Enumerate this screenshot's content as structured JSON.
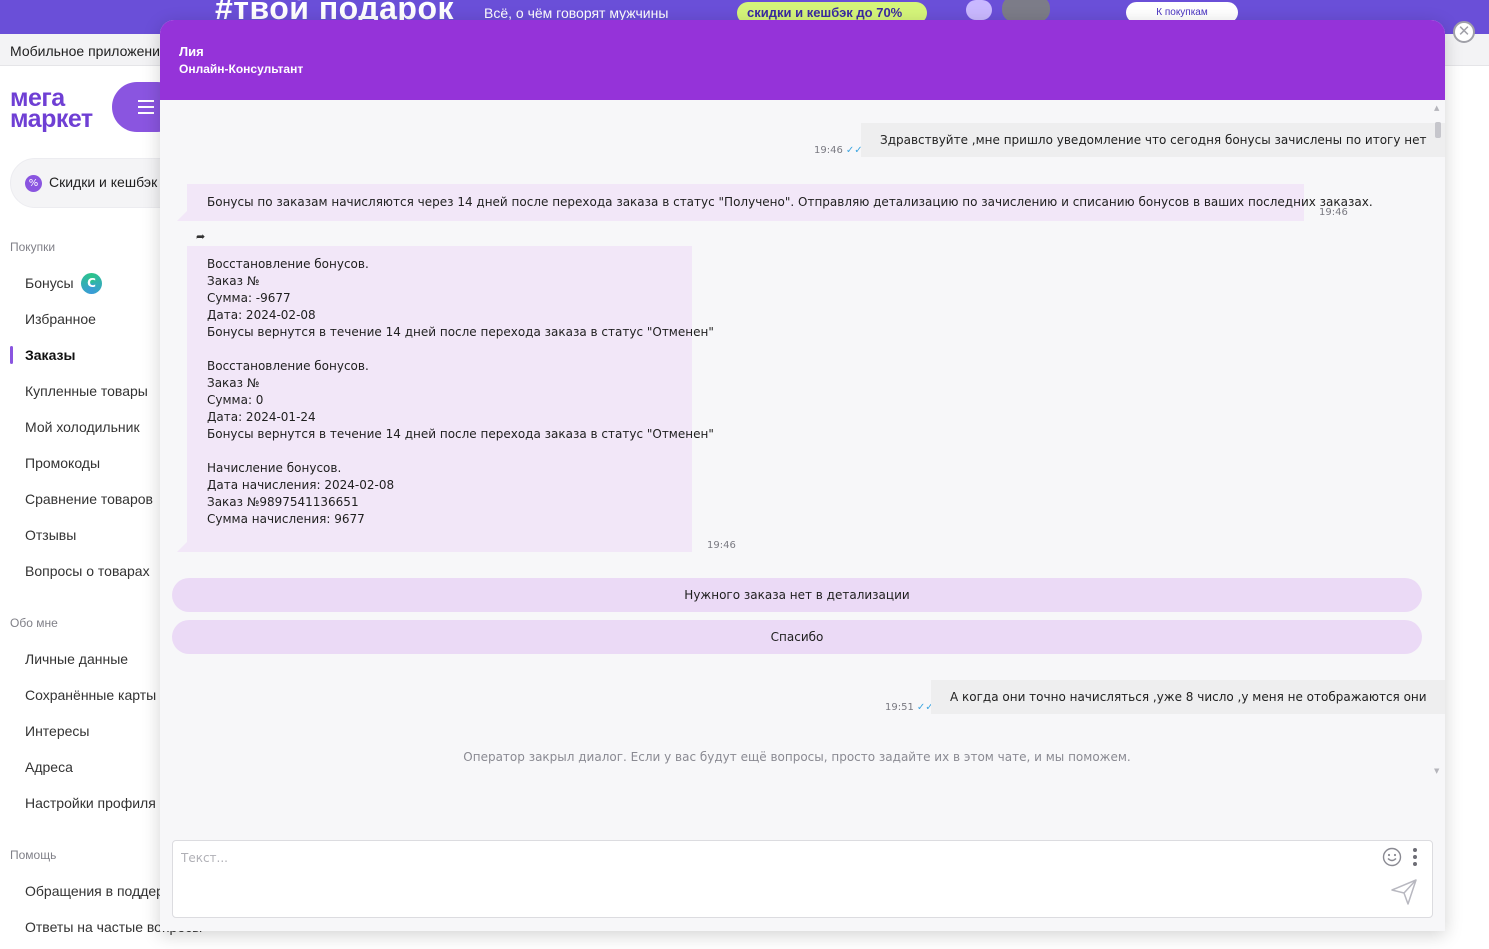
{
  "background": {
    "promo": {
      "hashtag": "#твой подарок",
      "subtitle": "Всё, о чём говорят мужчины",
      "pill": "скидки и кешбэк до 70%",
      "button": "К покупкам"
    },
    "appbar_text": "Мобильное приложение",
    "logo": {
      "line1": "мега",
      "line2": "маркет"
    },
    "search_text": "Скидки и кешбэк",
    "sidebar": {
      "sections": [
        {
          "label": "Покупки",
          "items": [
            "Бонусы",
            "Избранное",
            "Заказы",
            "Купленные товары",
            "Мой холодильник",
            "Промокоды",
            "Сравнение товаров",
            "Отзывы",
            "Вопросы о товарах"
          ]
        },
        {
          "label": "Обо мне",
          "items": [
            "Личные данные",
            "Сохранённые карты",
            "Интересы",
            "Адреса",
            "Настройки профиля"
          ]
        },
        {
          "label": "Помощь",
          "items": [
            "Обращения в поддержку",
            "Ответы на частые вопросы"
          ]
        }
      ],
      "active_item": "Заказы",
      "bonus_badge": "C"
    }
  },
  "chat": {
    "agent_name": "Лия",
    "agent_role": "Онлайн-Консультант",
    "close_glyph": "✕",
    "messages": [
      {
        "direction": "out",
        "text": "Здравствуйте ,мне пришло уведомление что сегодня бонусы зачислены по итогу нет",
        "time": "19:46",
        "read": "✓✓"
      },
      {
        "direction": "in",
        "text": "Бонусы по заказам начисляются через 14 дней после перехода заказа в статус \"Получено\". Отправляю детализацию по зачислению и списанию бонусов в ваших последних заказах.",
        "time": "19:46"
      },
      {
        "direction": "in",
        "forwarded_glyph": "➦",
        "time": "19:46",
        "blocks": [
          [
            "Восстановление бонусов.",
            "Заказ №",
            "Сумма: -9677",
            "Дата: 2024-02-08",
            "Бонусы вернутся в течение 14 дней после перехода заказа в статус \"Отменен\""
          ],
          [
            "Восстановление бонусов.",
            "Заказ №",
            "Сумма: 0",
            "Дата: 2024-01-24",
            "Бонусы вернутся в течение 14 дней после перехода заказа в статус \"Отменен\""
          ],
          [
            "Начисление бонусов.",
            "Дата начисления: 2024-02-08",
            "Заказ №9897541136651",
            "Сумма начисления: 9677"
          ]
        ]
      },
      {
        "direction": "out",
        "text": "А когда они точно начисляться ,уже 8 число ,у меня не отображаются они",
        "time": "19:51",
        "read": "✓✓"
      }
    ],
    "quick_replies": [
      "Нужного заказа нет в детализации",
      "Спасибо"
    ],
    "system_note": "Оператор закрыл диалог. Если у вас будут ещё вопросы, просто задайте их в этом чате, и мы поможем.",
    "composer": {
      "placeholder": "Текст...",
      "value": ""
    },
    "icons": {
      "emoji": "emoji-icon",
      "more": "more-vertical-icon",
      "send": "send-icon"
    },
    "colors": {
      "header": "#9533d9",
      "incoming_bubble": "#f2e7f8",
      "outgoing_bubble": "#eeeeef",
      "quick_reply": "#ebdaf6",
      "read_check": "#3fa6e0"
    }
  }
}
